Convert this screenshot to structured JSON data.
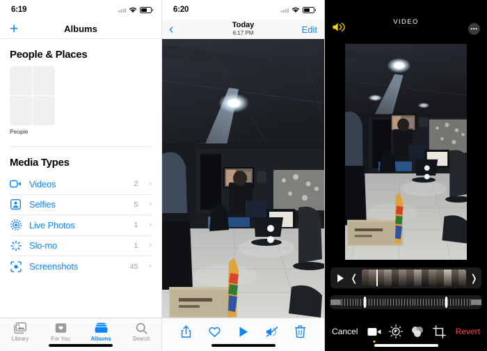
{
  "panel_albums": {
    "status": {
      "time": "6:19",
      "wifi_icon": "wifi-icon",
      "battery_icon": "battery-icon",
      "signal_icon": "signal-dots-icon"
    },
    "nav": {
      "add_icon": "plus-icon",
      "title": "Albums"
    },
    "people_places": {
      "header": "People & Places",
      "tile_label": "People",
      "tiles": [
        "",
        "",
        "",
        ""
      ]
    },
    "media_types": {
      "header": "Media Types",
      "rows": [
        {
          "icon": "video-camera-icon",
          "label": "Videos",
          "count": "2",
          "chevron": "chevron-right-icon"
        },
        {
          "icon": "selfie-person-icon",
          "label": "Selfies",
          "count": "5",
          "chevron": "chevron-right-icon"
        },
        {
          "icon": "live-photo-icon",
          "label": "Live Photos",
          "count": "1",
          "chevron": "chevron-right-icon"
        },
        {
          "icon": "slo-mo-icon",
          "label": "Slo-mo",
          "count": "1",
          "chevron": "chevron-right-icon"
        },
        {
          "icon": "screenshot-icon",
          "label": "Screenshots",
          "count": "45",
          "chevron": "chevron-right-icon"
        }
      ]
    },
    "tabbar": {
      "tabs": [
        {
          "icon": "library-photos-icon",
          "label": "Library",
          "active": false
        },
        {
          "icon": "for-you-heart-icon",
          "label": "For You",
          "active": false
        },
        {
          "icon": "albums-stack-icon",
          "label": "Albums",
          "active": true
        },
        {
          "icon": "search-icon",
          "label": "Search",
          "active": false
        }
      ]
    }
  },
  "panel_photo": {
    "status": {
      "time": "6:20"
    },
    "nav": {
      "back_icon": "chevron-left-icon",
      "title": "Today",
      "subtitle": "6:17 PM",
      "edit_label": "Edit"
    },
    "toolbar": [
      {
        "icon": "share-icon",
        "name": "share-button"
      },
      {
        "icon": "heart-icon",
        "name": "favorite-button"
      },
      {
        "icon": "play-icon",
        "name": "play-button"
      },
      {
        "icon": "speaker-mute-icon",
        "name": "mute-button"
      },
      {
        "icon": "trash-icon",
        "name": "delete-button"
      }
    ]
  },
  "panel_editor": {
    "nav": {
      "audio_icon": "speaker-on-icon",
      "title": "VIDEO",
      "more_icon": "more-ellipsis-icon"
    },
    "trim": {
      "play_icon": "play-icon",
      "left_handle": "trim-left-handle",
      "right_handle": "trim-right-handle",
      "playhead": "playhead-marker"
    },
    "speed": {
      "label": "speed-ramp-slider",
      "left_handle_pct": 22,
      "right_handle_pct": 76
    },
    "toolbar": {
      "cancel_label": "Cancel",
      "revert_label": "Revert",
      "tools": [
        {
          "icon": "video-trim-icon",
          "name": "tool-video",
          "active": true
        },
        {
          "icon": "adjust-dial-icon",
          "name": "tool-adjust",
          "active": false
        },
        {
          "icon": "filters-circles-icon",
          "name": "tool-filters",
          "active": false
        },
        {
          "icon": "crop-rotate-icon",
          "name": "tool-crop",
          "active": false
        }
      ]
    }
  },
  "colors": {
    "accent_blue": "#0a84ff",
    "revert_red": "#ff453a",
    "audio_yellow": "#ffd60a",
    "tile_gray": "#efeff0"
  }
}
